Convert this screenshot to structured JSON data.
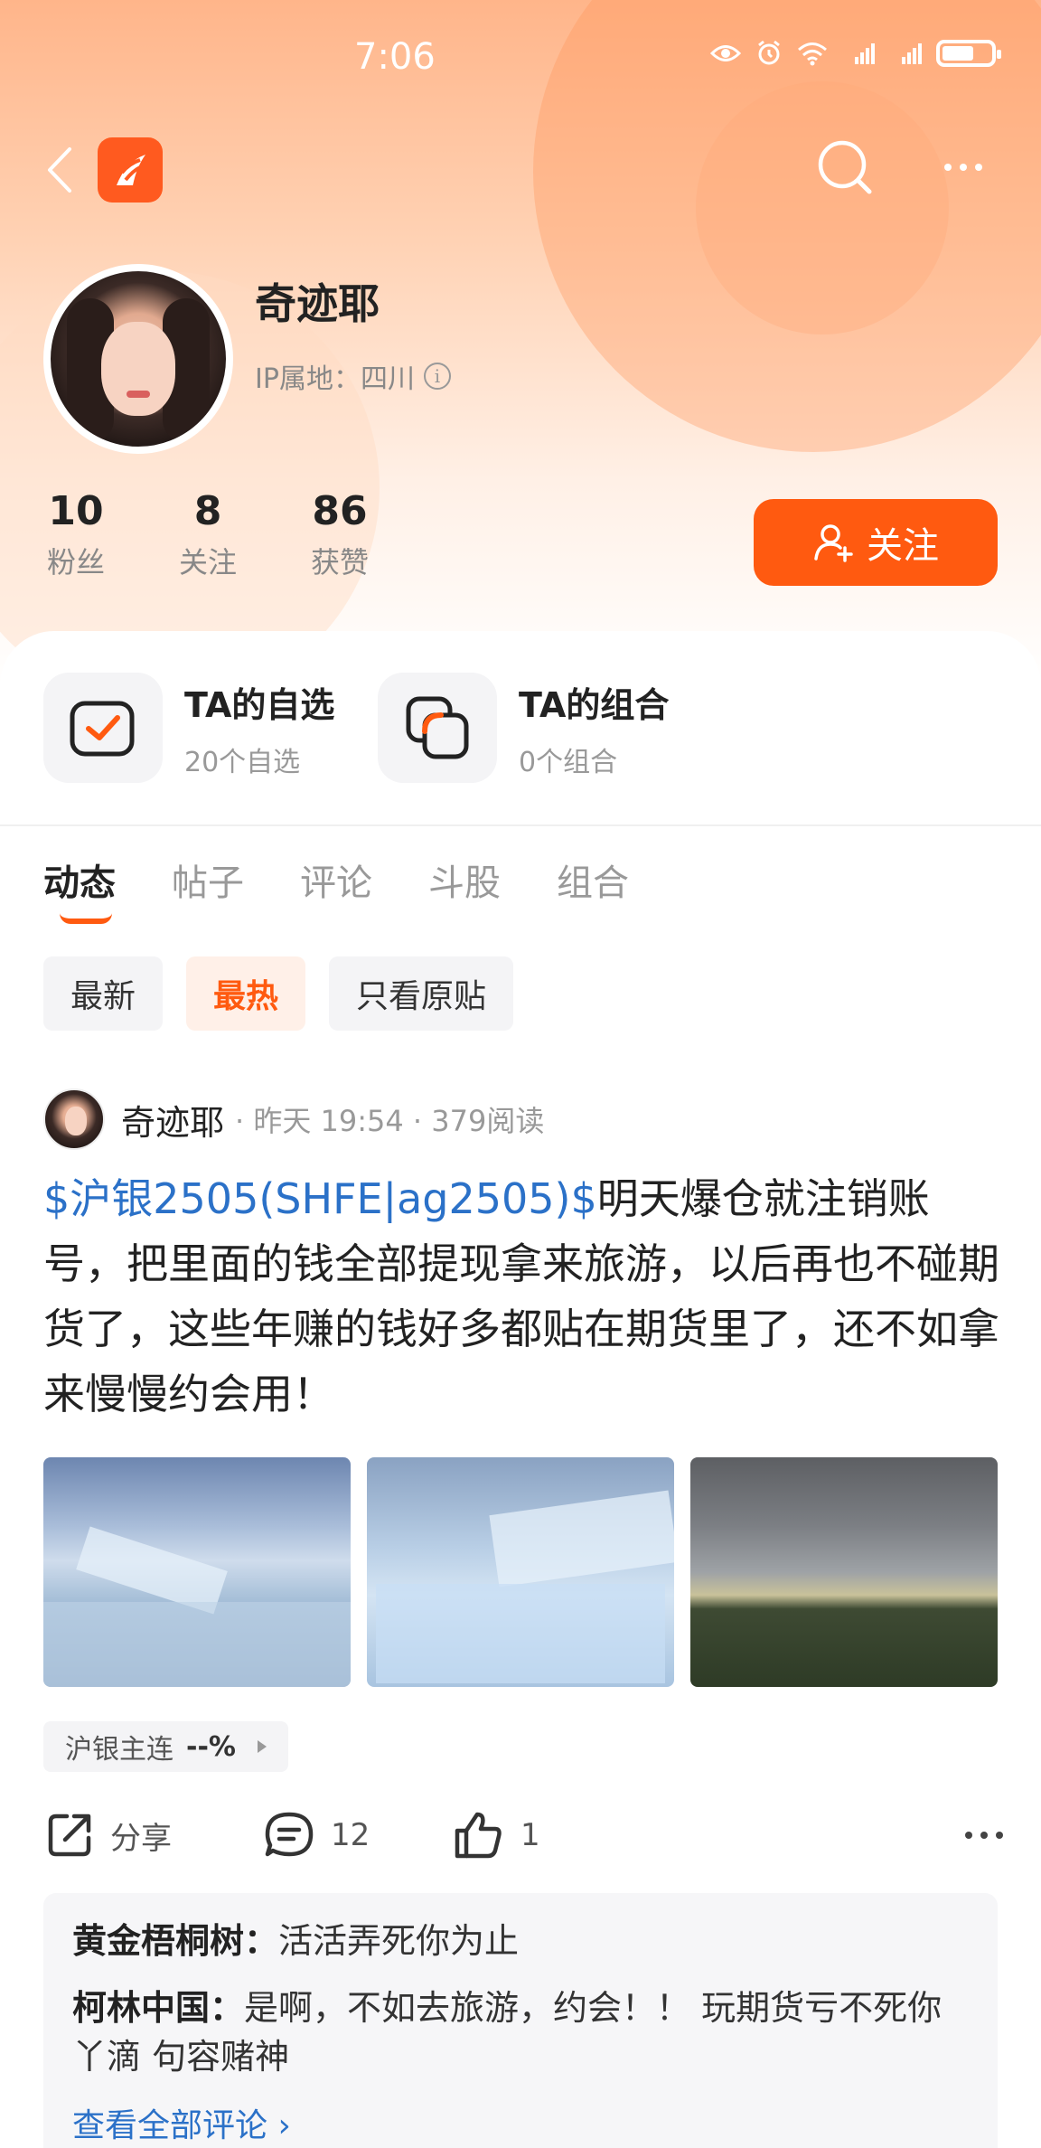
{
  "status_bar": {
    "time": "7:06"
  },
  "profile": {
    "name": "奇迹耶",
    "ip_location": "IP属地：四川",
    "stats": [
      {
        "value": "10",
        "label": "粉丝"
      },
      {
        "value": "8",
        "label": "关注"
      },
      {
        "value": "86",
        "label": "获赞"
      }
    ],
    "follow_label": "关注"
  },
  "quick_links": [
    {
      "title": "TA的自选",
      "subtitle": "20个自选"
    },
    {
      "title": "TA的组合",
      "subtitle": "0个组合"
    }
  ],
  "tabs": [
    "动态",
    "帖子",
    "评论",
    "斗股",
    "组合"
  ],
  "active_tab": "动态",
  "filters": [
    "最新",
    "最热",
    "只看原贴"
  ],
  "active_filter": "最热",
  "post": {
    "author": "奇迹耶",
    "meta": "· 昨天 19:54 · 379阅读",
    "stock_link": "$沪银2505(SHFE|ag2505)$",
    "text": "明天爆仓就注销账号，把里面的钱全部提现拿来旅游，以后再也不碰期货了，这些年赚的钱好多都贴在期货里了，还不如拿来慢慢约会用！",
    "quote_name": "沪银主连",
    "quote_value": "--%",
    "share_label": "分享",
    "comment_count": "12",
    "like_count": "1",
    "comments": [
      {
        "user": "黄金梧桐树：",
        "text": "活活弄死你为止"
      },
      {
        "user": "柯林中国：",
        "text": "是啊，不如去旅游，约会！！ 玩期货亏不死你丫滴  句容赌神"
      }
    ],
    "view_all": "查看全部评论 ›"
  },
  "colors": {
    "accent": "#ff5a10",
    "link": "#2b71c8"
  }
}
